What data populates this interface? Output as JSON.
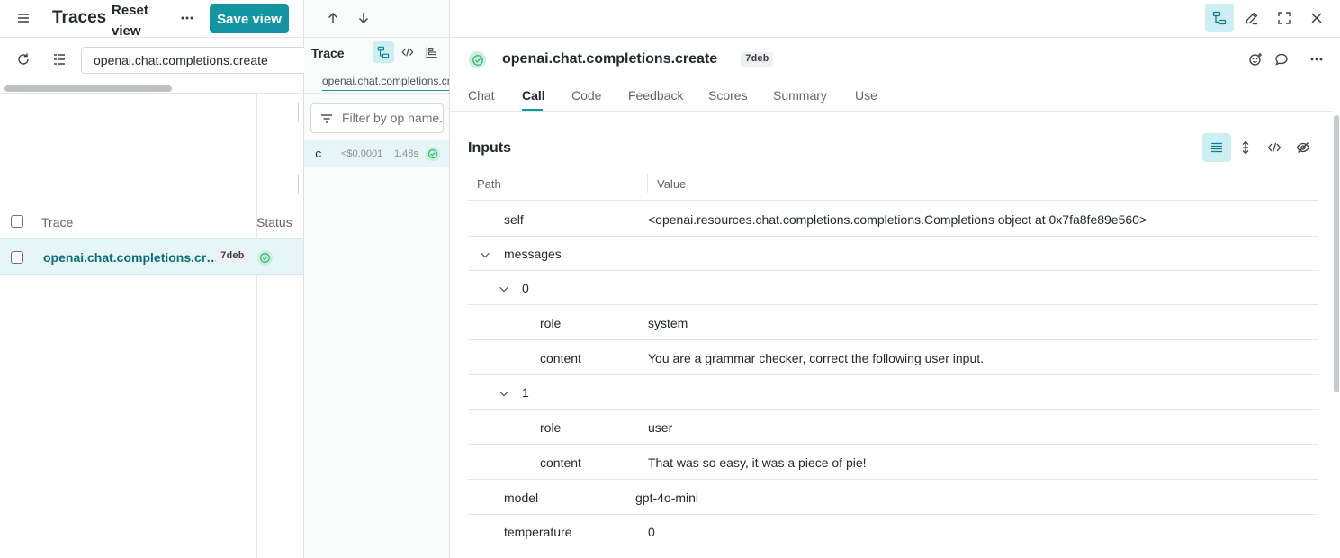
{
  "left": {
    "title": "Traces",
    "reset_view": "Reset view",
    "save_view": "Save view",
    "search_value": "openai.chat.completions.create",
    "columns": {
      "trace": "Trace",
      "status": "Status"
    },
    "rows": [
      {
        "name": "openai.chat.completions.cr…",
        "id": "7deb",
        "status": "success"
      }
    ]
  },
  "middle": {
    "title": "Trace",
    "tab_label": "openai.chat.completions.create",
    "filter_placeholder": "Filter by op name.",
    "call": {
      "letter": "c",
      "cost": "<$0.0001",
      "time": "1.48s"
    }
  },
  "detail": {
    "title": "openai.chat.completions.create",
    "id": "7deb",
    "tabs": [
      "Chat",
      "Call",
      "Code",
      "Feedback",
      "Scores",
      "Summary",
      "Use"
    ],
    "active_tab": "Call",
    "section_title": "Inputs",
    "columns": {
      "path": "Path",
      "value": "Value"
    },
    "rows": [
      {
        "key": "self",
        "value": "<openai.resources.chat.completions.completions.Completions object at 0x7fa8fe89e560>"
      },
      {
        "key": "messages",
        "value": ""
      },
      {
        "key": "0",
        "value": ""
      },
      {
        "key": "role",
        "value": "system"
      },
      {
        "key": "content",
        "value": "You are a grammar checker, correct the following user input."
      },
      {
        "key": "1",
        "value": ""
      },
      {
        "key": "role",
        "value": "user"
      },
      {
        "key": "content",
        "value": "That was so easy, it was a piece of pie!"
      },
      {
        "key": "model",
        "value": "gpt-4o-mini"
      },
      {
        "key": "temperature",
        "value": "0"
      }
    ]
  },
  "colors": {
    "accent": "#1495a3",
    "selected_row": "#e6f6f8",
    "success": "#2bb673"
  }
}
